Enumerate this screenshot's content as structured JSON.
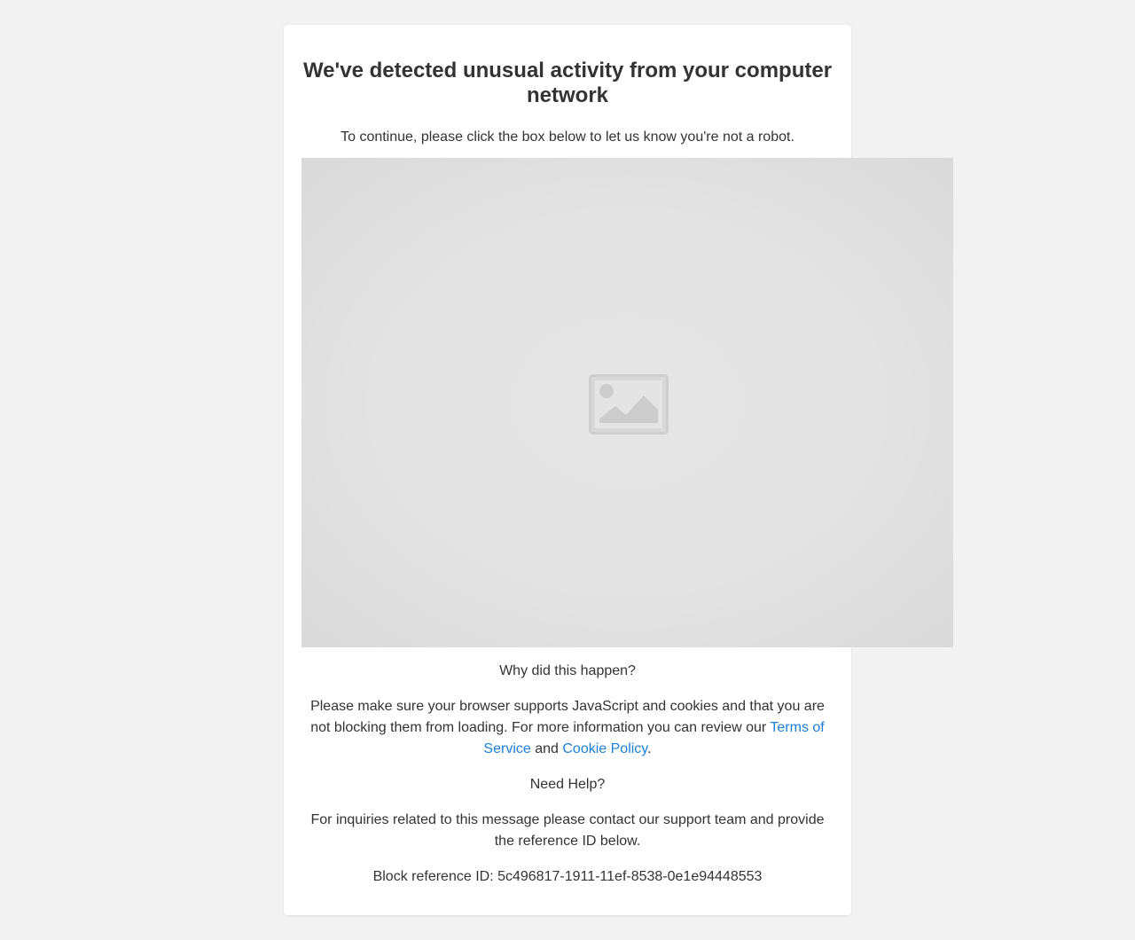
{
  "heading": "We've detected unusual activity from your computer network",
  "instruction": "To continue, please click the box below to let us know you're not a robot.",
  "captcha": {
    "icon": "image-placeholder-icon"
  },
  "why": {
    "title": "Why did this happen?",
    "text_before": "Please make sure your browser supports JavaScript and cookies and that you are not blocking them from loading. For more information you can review our ",
    "terms_link": "Terms of Service",
    "and": " and ",
    "cookie_link": "Cookie Policy",
    "period": "."
  },
  "help": {
    "title": "Need Help?",
    "text": "For inquiries related to this message please contact our support team and provide the reference ID below."
  },
  "reference": {
    "label": "Block reference ID: ",
    "id": "5c496817-1911-11ef-8538-0e1e94448553"
  },
  "colors": {
    "background": "#f2f2f2",
    "card": "#ffffff",
    "text": "#333333",
    "link": "#1a7fd9"
  }
}
